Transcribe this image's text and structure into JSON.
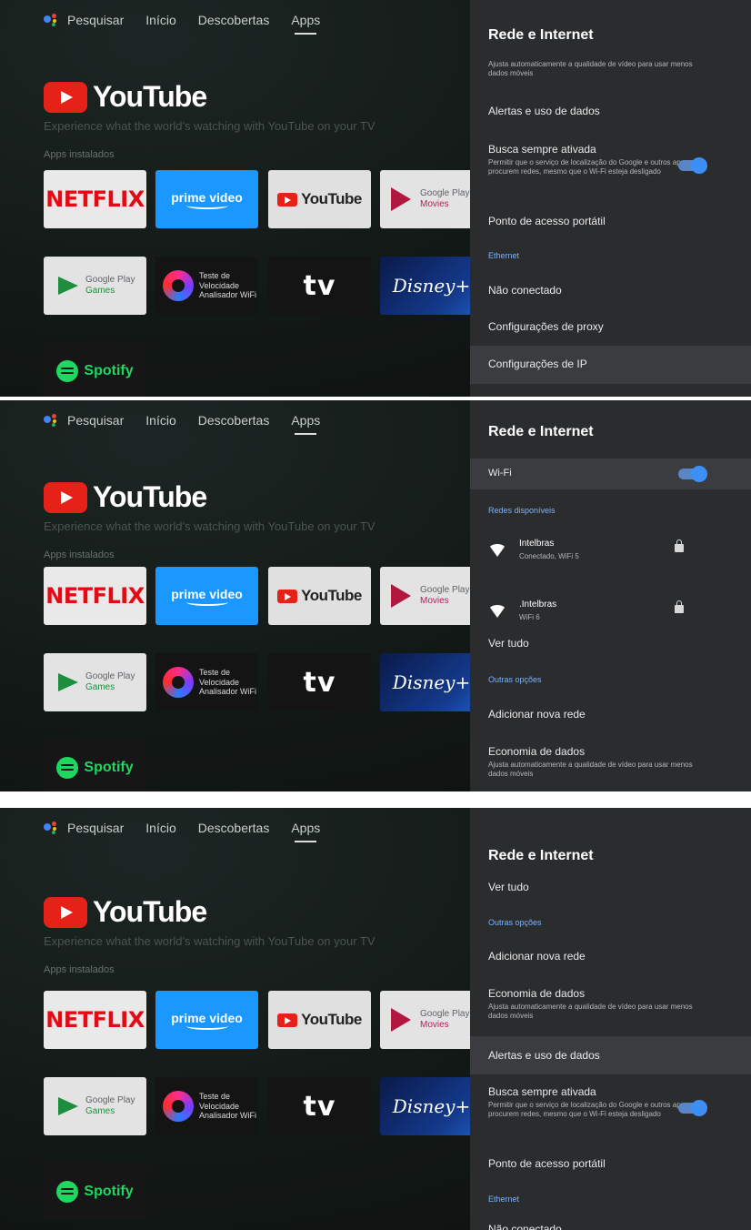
{
  "nav": {
    "search": "Pesquisar",
    "home": "Início",
    "discover": "Descobertas",
    "apps": "Apps"
  },
  "hero": {
    "brand": "YouTube",
    "tagline": "Experience what the world's watching with YouTube on your TV"
  },
  "installed_label": "Apps instalados",
  "apps": {
    "netflix": "NETFLIX",
    "prime": "prime video",
    "youtube": "YouTube",
    "movies_brand": "Google Play",
    "movies_name": "Movies",
    "games_brand": "Google Play",
    "games_name": "Games",
    "speed": [
      "Teste de",
      "Velocidade",
      "Analisador WiFi"
    ],
    "appletv": "tv",
    "disney": "Disney+",
    "spotify": "Spotify"
  },
  "panel": {
    "title": "Rede e Internet",
    "wifi": "Wi-Fi",
    "available_networks": "Redes disponíveis",
    "networks": [
      {
        "name": "Intelbras",
        "status": "Conectado, WiFi 5"
      },
      {
        "name": ".Intelbras",
        "status": "WiFi 6"
      }
    ],
    "see_all": "Ver tudo",
    "other_options": "Outras opções",
    "add_network": "Adicionar nova rede",
    "data_saver": "Economia de dados",
    "data_saver_desc": "Ajusta automaticamente a qualidade de vídeo para usar menos dados móveis",
    "data_alerts": "Alertas e uso de dados",
    "always_scan": "Busca sempre ativada",
    "always_scan_desc": "Permitir que o serviço de localização do Google e outros apps procurem redes, mesmo que o Wi-Fi esteja desligado",
    "hotspot": "Ponto de acesso portátil",
    "ethernet": "Ethernet",
    "not_connected": "Não conectado",
    "proxy": "Configurações de proxy",
    "ip": "Configurações de IP"
  },
  "colors": {
    "accent_blue": "#3d8ff5",
    "section_blue": "#7cb4ff",
    "panel_bg": "#2a2c2e",
    "youtube_red": "#e62117"
  }
}
